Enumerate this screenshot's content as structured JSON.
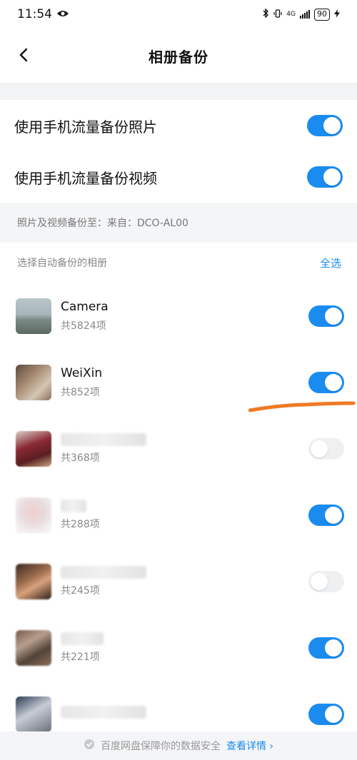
{
  "status_bar": {
    "time": "11:54",
    "network": "4G",
    "battery": "90"
  },
  "header": {
    "title": "相册备份"
  },
  "settings": [
    {
      "label": "使用手机流量备份照片",
      "enabled": true
    },
    {
      "label": "使用手机流量备份视频",
      "enabled": true
    }
  ],
  "destination": {
    "text": "照片及视频备份至：来自：DCO-AL00"
  },
  "album_section": {
    "label": "选择自动备份的相册",
    "select_all": "全选"
  },
  "albums": [
    {
      "name": "Camera",
      "count": "共5824项",
      "enabled": true
    },
    {
      "name": "WeiXin",
      "count": "共852项",
      "enabled": true
    },
    {
      "name": "",
      "count": "共368项",
      "enabled": false
    },
    {
      "name": "",
      "count": "共288项",
      "enabled": true
    },
    {
      "name": "",
      "count": "共245项",
      "enabled": false
    },
    {
      "name": "",
      "count": "共221项",
      "enabled": true
    },
    {
      "name": "",
      "count": "",
      "enabled": true
    }
  ],
  "footer": {
    "text": "百度网盘保障你的数据安全",
    "link": "查看详情"
  },
  "colors": {
    "accent": "#1a8cf0",
    "annotation": "#f07a22"
  }
}
